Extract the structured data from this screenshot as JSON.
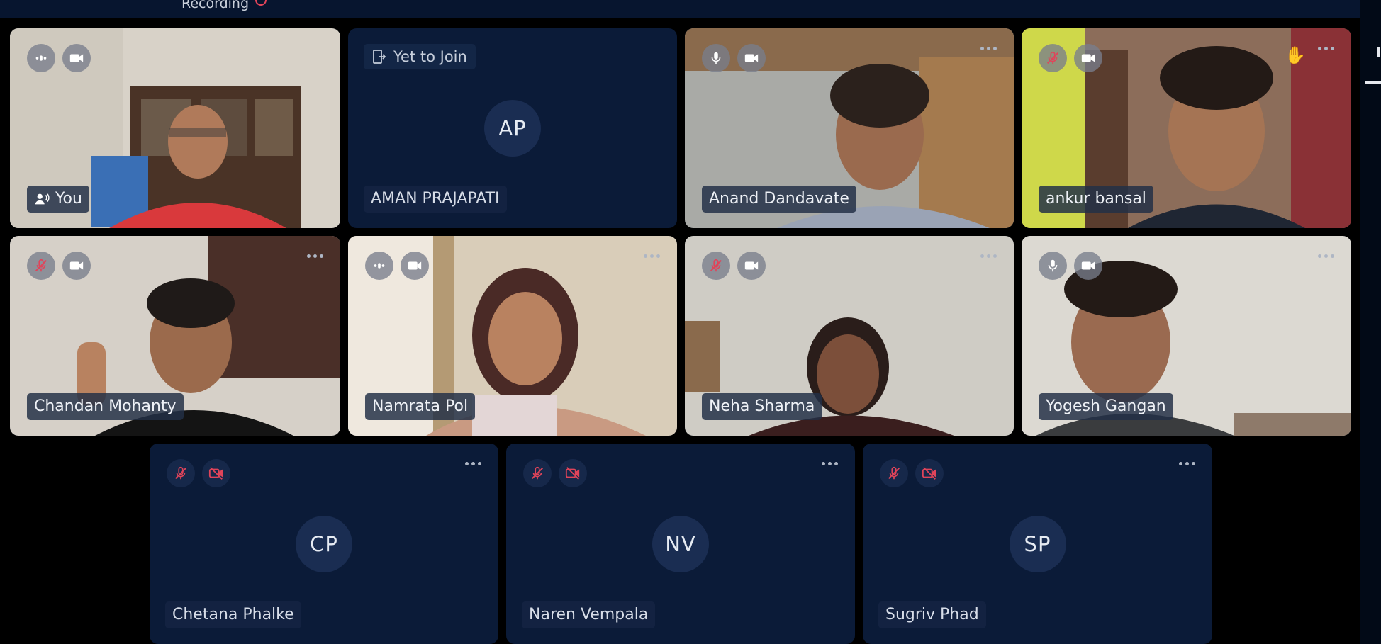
{
  "header": {
    "recording_label": "Recording"
  },
  "colors": {
    "tile_empty": "#0b1b38",
    "avatar_bg": "#1a2d52",
    "muted_red": "#e0445a",
    "hand_raise": "#e9b84a"
  },
  "tiles": [
    {
      "name": "You",
      "type": "video",
      "mic": "speaking",
      "cam": "on",
      "presenter_icon": "person-speaking-icon"
    },
    {
      "name": "AMAN PRAJAPATI",
      "type": "avatar",
      "initials": "AP",
      "status": "Yet to Join"
    },
    {
      "name": "Anand Dandavate",
      "type": "video",
      "mic": "on",
      "cam": "on"
    },
    {
      "name": "ankur bansal",
      "type": "video",
      "mic": "muted",
      "cam": "on",
      "hand_raised": true
    },
    {
      "name": "Chandan Mohanty",
      "type": "video",
      "mic": "muted",
      "cam": "on"
    },
    {
      "name": "Namrata Pol",
      "type": "video",
      "mic": "speaking",
      "cam": "on"
    },
    {
      "name": "Neha Sharma",
      "type": "video",
      "mic": "muted",
      "cam": "on"
    },
    {
      "name": "Yogesh Gangan",
      "type": "video",
      "mic": "on",
      "cam": "on"
    },
    {
      "name": "Chetana Phalke",
      "type": "avatar",
      "initials": "CP",
      "mic": "muted",
      "cam": "off"
    },
    {
      "name": "Naren Vempala",
      "type": "avatar",
      "initials": "NV",
      "mic": "muted",
      "cam": "off"
    },
    {
      "name": "Sugriv Phad",
      "type": "avatar",
      "initials": "SP",
      "mic": "muted",
      "cam": "off"
    }
  ]
}
